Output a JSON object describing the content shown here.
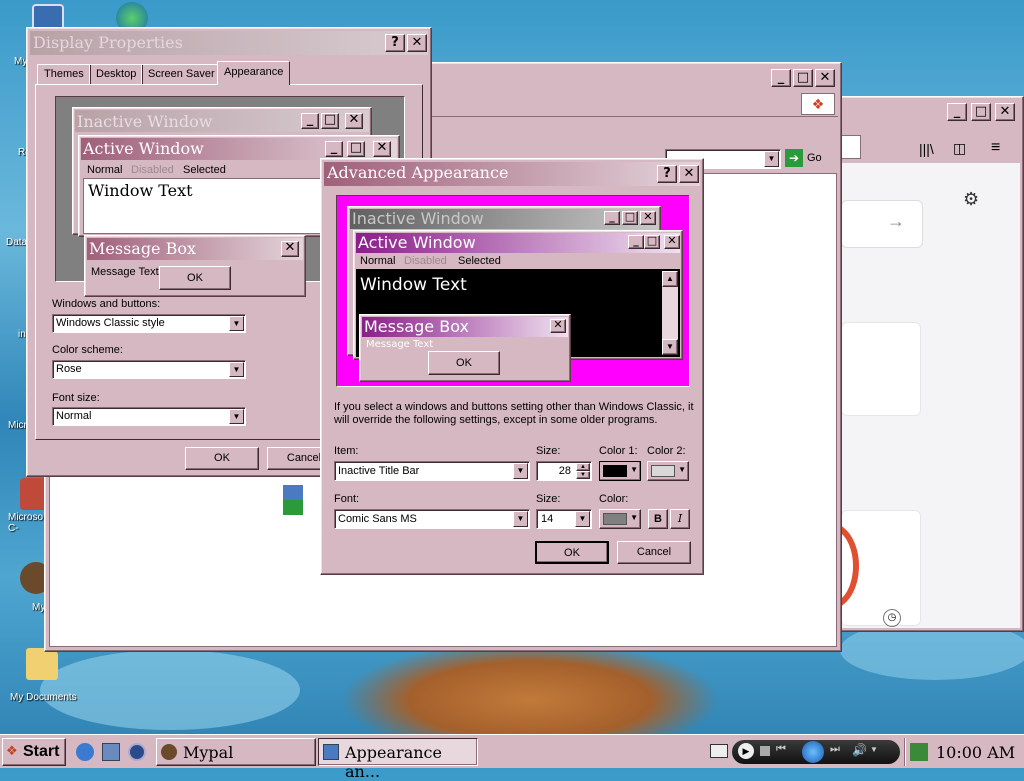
{
  "desktop": {
    "icons": [
      {
        "label": "My"
      },
      {
        "label": "Re"
      },
      {
        "label": "Data"
      },
      {
        "label": "ins"
      },
      {
        "label": "Micro"
      },
      {
        "label": "Microso C-"
      },
      {
        "label": "My"
      },
      {
        "label": "My Documents"
      }
    ]
  },
  "browser": {
    "go_label": "Go"
  },
  "display_props": {
    "title": "Display Properties",
    "help": "?",
    "close": "✕",
    "tabs": [
      "Themes",
      "Desktop",
      "Screen Saver",
      "Appearance"
    ],
    "preview": {
      "inactive_title": "Inactive Window",
      "active_title": "Active Window",
      "menu": [
        "Normal",
        "Disabled",
        "Selected"
      ],
      "window_text": "Window Text",
      "msgbox_title": "Message Box",
      "msgbox_text": "Message Text",
      "ok": "OK"
    },
    "windows_buttons_label": "Windows and buttons:",
    "windows_buttons_value": "Windows Classic style",
    "color_scheme_label": "Color scheme:",
    "color_scheme_value": "Rose",
    "font_size_label": "Font size:",
    "font_size_value": "Normal",
    "ok": "OK",
    "cancel": "Cancel"
  },
  "advanced": {
    "title": "Advanced Appearance",
    "help": "?",
    "close": "✕",
    "preview": {
      "inactive_title": "Inactive Window",
      "active_title": "Active Window",
      "menu": [
        "Normal",
        "Disabled",
        "Selected"
      ],
      "window_text": "Window Text",
      "msgbox_title": "Message Box",
      "msgbox_text": "Message Text",
      "ok": "OK"
    },
    "note": "If you select a windows and buttons setting other than Windows Classic, it will override the following settings, except in some older programs.",
    "item_label": "Item:",
    "item_value": "Inactive Title Bar",
    "size_label": "Size:",
    "item_size": "28",
    "color1_label": "Color 1:",
    "color2_label": "Color 2:",
    "font_label": "Font:",
    "font_value": "Comic Sans MS",
    "font_size_label": "Size:",
    "font_size": "14",
    "color_label": "Color:",
    "bold": "B",
    "italic": "I",
    "ok": "OK",
    "cancel": "Cancel",
    "colors": {
      "color1": "#000000",
      "color2": "#d8d8d8",
      "font_color": "#808080"
    }
  },
  "taskbar": {
    "start": "Start",
    "tasks": [
      {
        "label": "Mypal"
      },
      {
        "label": "Appearance an..."
      }
    ],
    "clock": "10:00 AM"
  },
  "theme": {
    "face": "#d6b8c2",
    "active_title_start": "#a0607a",
    "inactive_title_start": "#b8a2a8",
    "magenta": "#ff00ff",
    "adv_active_start": "#8a1e8a"
  }
}
